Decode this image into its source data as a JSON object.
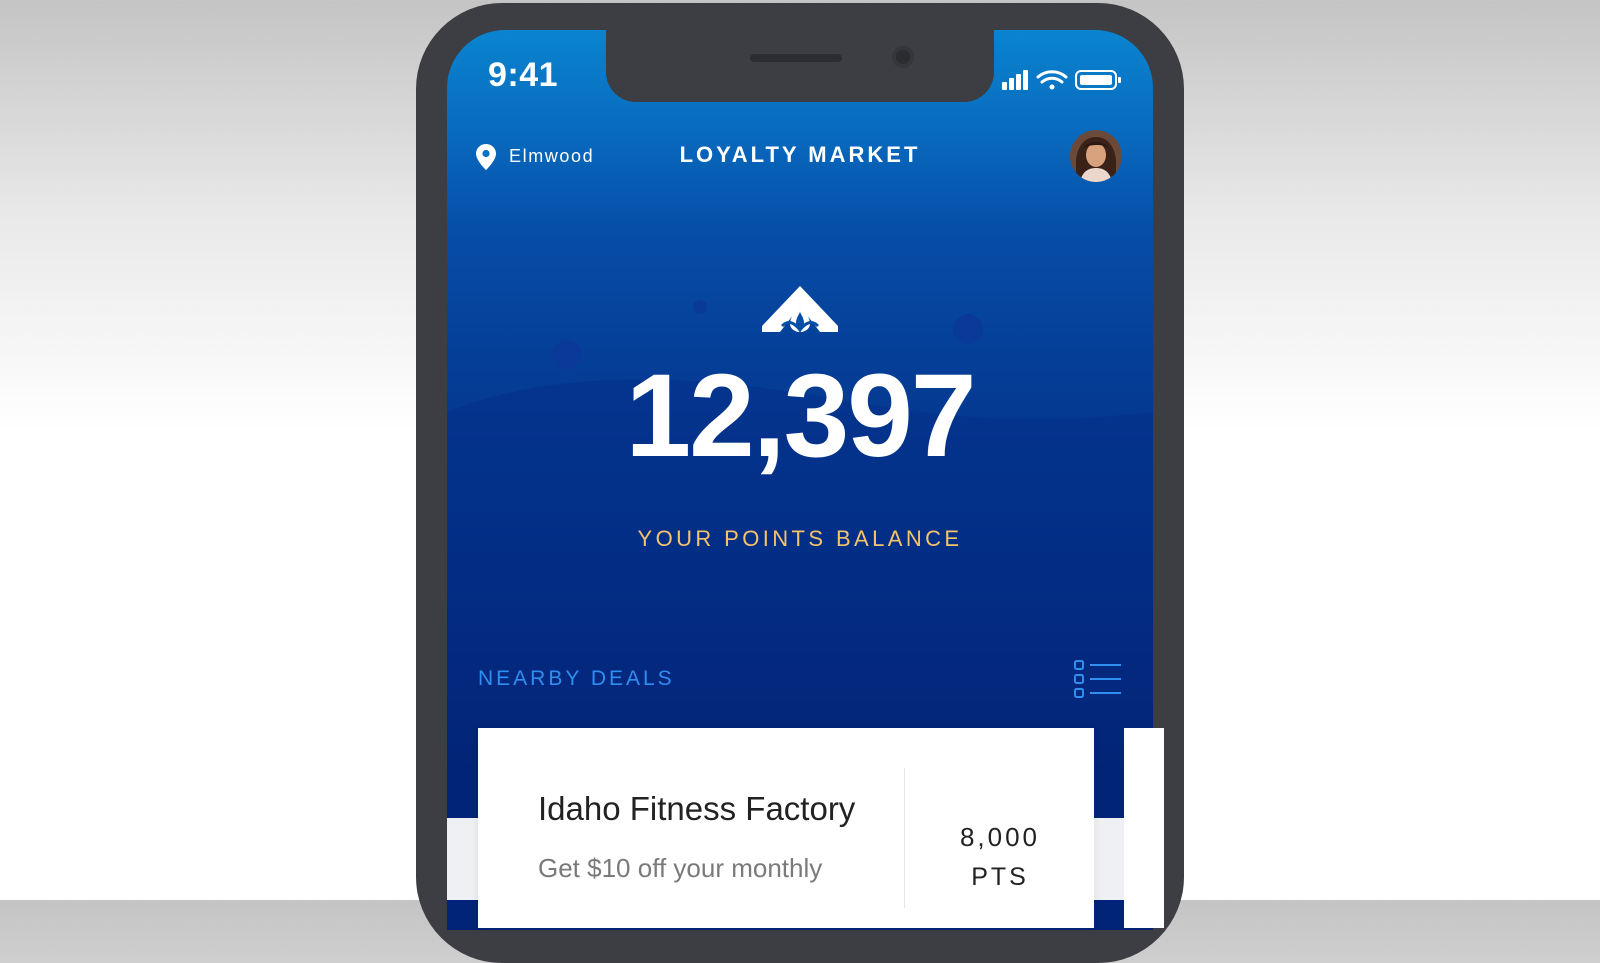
{
  "status_bar": {
    "time": "9:41",
    "signal_icon": "cellular-signal-icon",
    "wifi_icon": "wifi-icon",
    "battery_icon": "battery-icon"
  },
  "header": {
    "location_icon": "location-pin-icon",
    "location": "Elmwood",
    "title": "LOYALTY MARKET",
    "avatar_icon": "user-avatar"
  },
  "balance": {
    "logo_icon": "brand-logo-icon",
    "points": "12,397",
    "label": "YOUR POINTS BALANCE"
  },
  "deals": {
    "section_title": "NEARBY DEALS",
    "view_toggle_icon": "list-view-icon",
    "items": [
      {
        "name": "Idaho Fitness Factory",
        "description": "Get $10 off your monthly",
        "points": "8,000",
        "points_unit": "PTS"
      }
    ]
  },
  "colors": {
    "accent": "#2f8ef0",
    "points_label": "#f4c46a",
    "background_top": "#0a84cf",
    "background_bottom": "#021864"
  }
}
